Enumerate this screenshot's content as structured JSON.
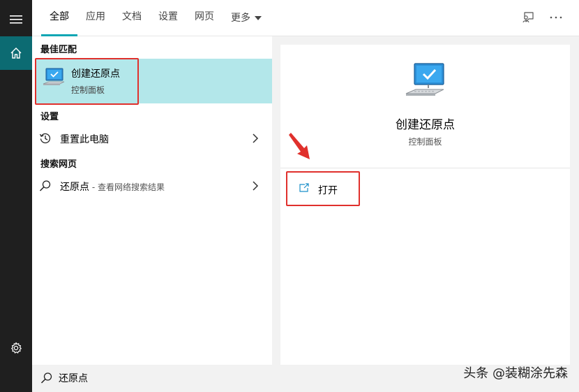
{
  "tabs": [
    {
      "label": "全部",
      "active": true
    },
    {
      "label": "应用"
    },
    {
      "label": "文档"
    },
    {
      "label": "设置"
    },
    {
      "label": "网页"
    },
    {
      "label": "更多"
    }
  ],
  "sections": {
    "best_match": "最佳匹配",
    "settings": "设置",
    "web": "搜索网页"
  },
  "best_match": {
    "title": "创建还原点",
    "subtitle": "控制面板",
    "icon": "computer-checkmark-icon"
  },
  "settings_result": {
    "label": "重置此电脑",
    "icon": "history-icon"
  },
  "web_result": {
    "query": "还原点",
    "hint": " - 查看网络搜索结果",
    "icon": "search-icon"
  },
  "preview": {
    "title": "创建还原点",
    "subtitle": "控制面板",
    "action_label": "打开",
    "action_icon": "open-external-icon"
  },
  "search": {
    "value": "还原点"
  },
  "watermark": "头条 @装糊涂先森",
  "colors": {
    "accent": "#0fa6b4",
    "highlight": "#b3e7ea",
    "annotation_red": "#e0302c",
    "rail": "#1f1f1f",
    "home_active": "#0c6b72"
  }
}
